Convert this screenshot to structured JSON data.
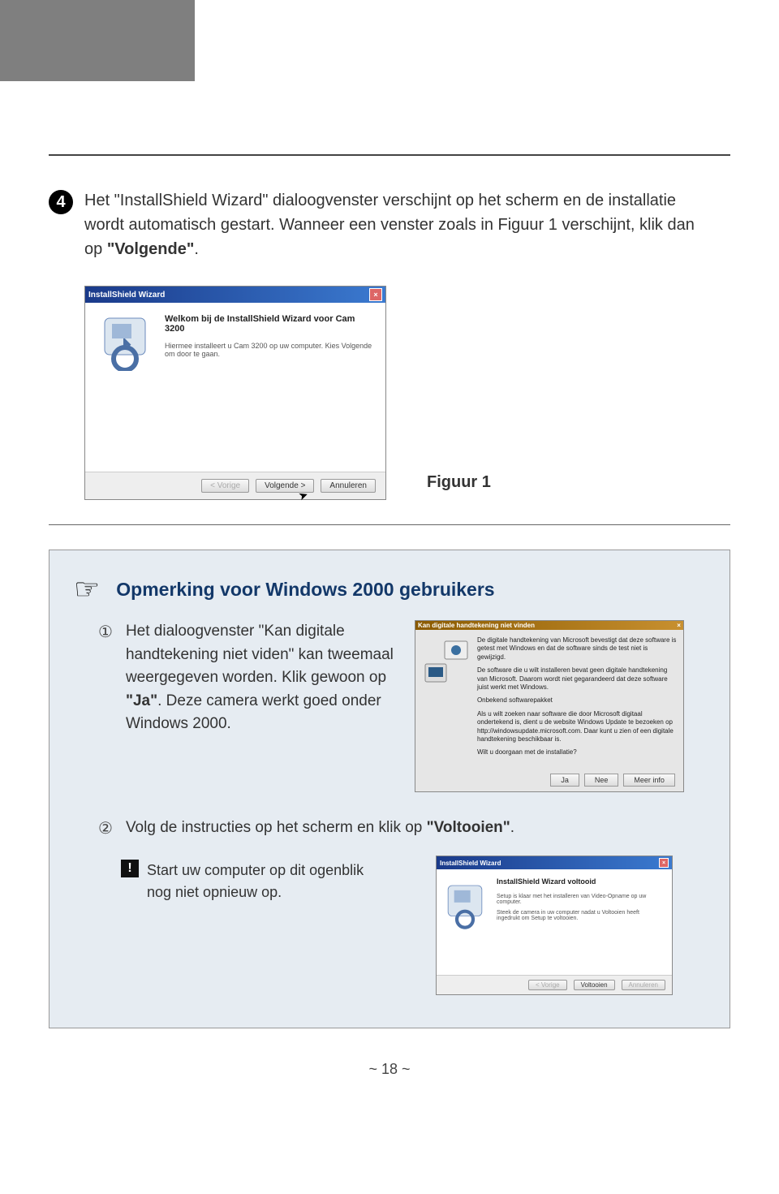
{
  "top_band": "",
  "step4": {
    "number": "4",
    "text_a": "Het \"InstallShield Wizard\" dialoogvenster verschijnt op het scherm en de installatie wordt automatisch gestart. Wanneer een venster zoals in Figuur 1 verschijnt, klik dan op ",
    "text_b_bold": "\"Volgende\"",
    "text_c": "."
  },
  "wizard1": {
    "title": "InstallShield Wizard",
    "heading": "Welkom bij de InstallShield Wizard voor Cam 3200",
    "body": "Hiermee installeert u Cam 3200 op uw computer. Kies Volgende om door te gaan.",
    "btn_back": "< Vorige",
    "btn_next": "Volgende >",
    "btn_cancel": "Annuleren"
  },
  "fig1_label": "Figuur 1",
  "note": {
    "title": "Opmerking voor Windows 2000 gebruikers",
    "item1": {
      "num": "①",
      "text_a": "Het dialoogvenster \"Kan digitale handtekening niet viden\" kan tweemaal weergegeven worden. Klik gewoon op ",
      "text_b_bold": "\"Ja\"",
      "text_c": ". Deze camera werkt goed onder Windows 2000."
    },
    "dialog": {
      "title": "Kan digitale handtekening niet vinden",
      "line1": "De digitale handtekening van Microsoft bevestigt dat deze software is getest met Windows en dat de software sinds de test niet is gewijzigd.",
      "line2": "De software die u wilt installeren bevat geen digitale handtekening van Microsoft. Daarom wordt niet gegarandeerd dat deze software juist werkt met Windows.",
      "line3": "Onbekend softwarepakket",
      "line4": "Als u wilt zoeken naar software die door Microsoft digitaal ondertekend is, dient u de website Windows Update te bezoeken op http://windowsupdate.microsoft.com. Daar kunt u zien of een digitale handtekening beschikbaar is.",
      "line5": "Wilt u doorgaan met de installatie?",
      "btn_yes": "Ja",
      "btn_no": "Nee",
      "btn_more": "Meer info"
    },
    "item2": {
      "num": "②",
      "text_a": "Volg de instructies op het scherm en klik op ",
      "text_b_bold": "\"Voltooien\"",
      "text_c": "."
    },
    "warn": {
      "icon": "!",
      "text": "Start uw computer op dit ogenblik nog niet opnieuw op."
    }
  },
  "wizard2": {
    "title": "InstallShield Wizard",
    "heading": "InstallShield Wizard voltooid",
    "body1": "Setup is klaar met het installeren van Video-Opname op uw computer.",
    "body2": "Steek de camera in uw computer nadat u Voltooien heeft ingedrukt om Setup te voltooien.",
    "btn_back": "< Vorige",
    "btn_finish": "Voltooien",
    "btn_cancel": "Annuleren"
  },
  "page_number": "~ 18 ~"
}
